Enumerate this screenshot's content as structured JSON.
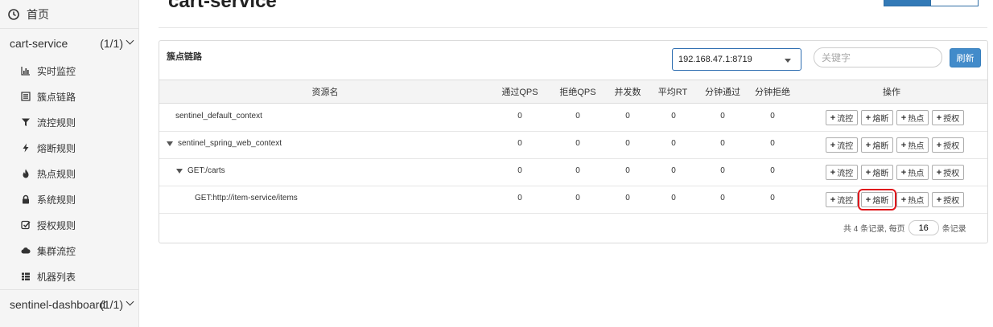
{
  "sidebar": {
    "home": "首页",
    "apps": [
      {
        "name": "cart-service",
        "count": "(1/1)"
      },
      {
        "name": "sentinel-dashboard",
        "count": "(1/1)"
      }
    ],
    "items": [
      {
        "label": "实时监控",
        "icon": "bar-chart-icon"
      },
      {
        "label": "簇点链路",
        "icon": "list-icon"
      },
      {
        "label": "流控规则",
        "icon": "filter-icon"
      },
      {
        "label": "熔断规则",
        "icon": "flash-icon"
      },
      {
        "label": "热点规则",
        "icon": "fire-icon"
      },
      {
        "label": "系统规则",
        "icon": "lock-icon"
      },
      {
        "label": "授权规则",
        "icon": "check-square-icon"
      },
      {
        "label": "集群流控",
        "icon": "cloud-icon"
      },
      {
        "label": "机器列表",
        "icon": "table-icon"
      }
    ]
  },
  "header": {
    "title": "cart-service"
  },
  "panel": {
    "title": "簇点链路",
    "machine": "192.168.47.1:8719",
    "search_placeholder": "关键字",
    "refresh": "刷新"
  },
  "table": {
    "columns": [
      "资源名",
      "通过QPS",
      "拒绝QPS",
      "并发数",
      "平均RT",
      "分钟通过",
      "分钟拒绝",
      "操作"
    ],
    "rows": [
      {
        "resource": "sentinel_default_context",
        "pass_qps": "0",
        "block_qps": "0",
        "concurrency": "0",
        "avg_rt": "0",
        "minute_pass": "0",
        "minute_block": "0"
      },
      {
        "resource": "sentinel_spring_web_context",
        "pass_qps": "0",
        "block_qps": "0",
        "concurrency": "0",
        "avg_rt": "0",
        "minute_pass": "0",
        "minute_block": "0"
      },
      {
        "resource": "GET:/carts",
        "pass_qps": "0",
        "block_qps": "0",
        "concurrency": "0",
        "avg_rt": "0",
        "minute_pass": "0",
        "minute_block": "0"
      },
      {
        "resource": "GET:http://item-service/items",
        "pass_qps": "0",
        "block_qps": "0",
        "concurrency": "0",
        "avg_rt": "0",
        "minute_pass": "0",
        "minute_block": "0"
      }
    ],
    "actions": {
      "flow": "流控",
      "degrade": "熔断",
      "hotspot": "热点",
      "authority": "授权"
    }
  },
  "footer": {
    "total_text": "共 4 条记录, 每页",
    "page_size": "16",
    "suffix": "条记录"
  },
  "colors": {
    "primary": "#337ab7",
    "highlight": "#e0171c"
  }
}
